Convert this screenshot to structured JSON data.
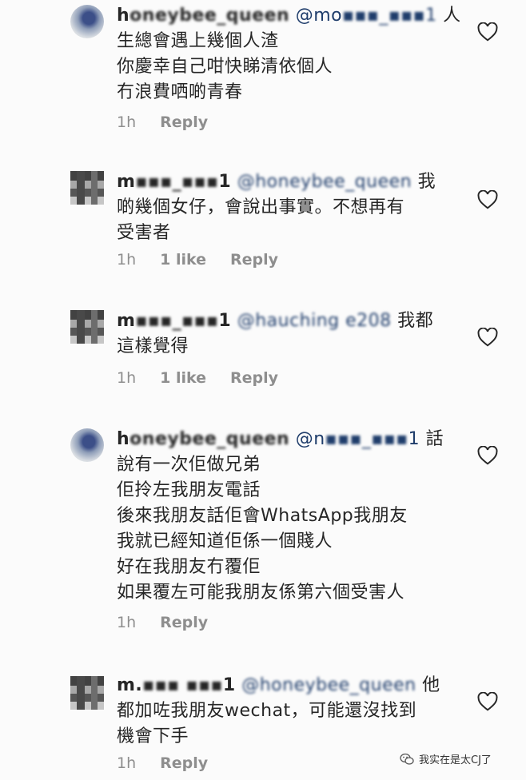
{
  "comments": [
    {
      "user_visible": "h",
      "user_blurred": "oneybee_queen",
      "mention_visible": "@mo",
      "mention_blurred": "▪▪▪_▪▪▪1",
      "lines": [
        "人",
        "生總會遇上幾個人渣",
        "你慶幸自己咁快睇清依個人",
        "冇浪費哂啲青春"
      ],
      "time": "1h",
      "likes": "",
      "reply": "Reply"
    },
    {
      "user_visible": "m",
      "user_blurred": "▪▪▪_▪▪▪",
      "user_tail": "1",
      "mention_blurred": "@honeybee_queen",
      "lines": [
        "我",
        "啲幾個女仔，會說出事實。不想再有",
        "受害者"
      ],
      "time": "1h",
      "likes": "1 like",
      "reply": "Reply"
    },
    {
      "user_visible": "m",
      "user_blurred": "▪▪▪_▪▪▪",
      "user_tail": "1",
      "mention_blurred": "@hauching e208",
      "lines": [
        "我都",
        "這樣覺得"
      ],
      "time": "1h",
      "likes": "1 like",
      "reply": "Reply"
    },
    {
      "user_visible": "h",
      "user_blurred": "oneybee_queen",
      "mention_visible": "@n",
      "mention_blurred": "▪▪▪_▪▪▪",
      "mention_tail": "1",
      "lines": [
        "話",
        "說有一次佢做兄弟",
        "佢拎左我朋友電話",
        "後來我朋友話佢會WhatsApp我朋友",
        "我就已經知道佢係一個賤人",
        "好在我朋友冇覆佢",
        "如果覆左可能我朋友係第六個受害人"
      ],
      "time": "1h",
      "likes": "",
      "reply": "Reply"
    },
    {
      "user_visible": "m.",
      "user_blurred": "▪▪▪ ▪▪▪",
      "user_tail": "1",
      "mention_blurred": "@honeybee_queen",
      "lines": [
        "他",
        "都加咗我朋友wechat，可能還沒找到",
        "機會下手"
      ],
      "time": "1h",
      "likes": "",
      "reply": "Reply"
    }
  ],
  "watermark": "我实在是太CJ了",
  "icons": {
    "like": "heart-outline-icon",
    "watermark": "wechat-icon"
  }
}
